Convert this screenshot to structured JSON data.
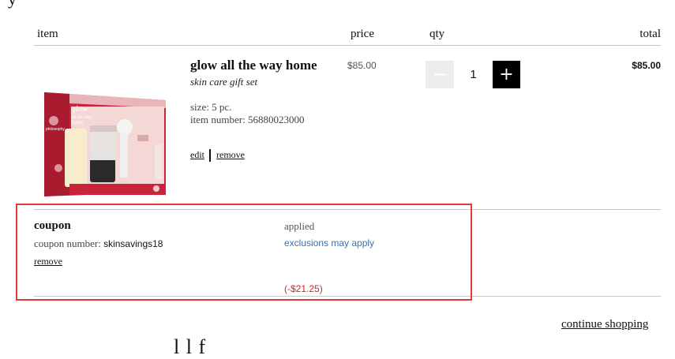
{
  "page": {
    "top_heading_fragment": "y",
    "bottom_heading_fragment": "l l f"
  },
  "table": {
    "headers": {
      "item": "item",
      "price": "price",
      "qty": "qty",
      "total": "total"
    }
  },
  "product": {
    "name": "glow all the way home",
    "subtitle": "skin care gift set",
    "size_label": "size:",
    "size_value": "5 pc.",
    "item_number_label": "item number:",
    "item_number_value": "56880023000",
    "edit_label": "edit",
    "remove_label": "remove",
    "price": "$85.00",
    "quantity": "1",
    "minus_symbol": "−",
    "plus_symbol": "+",
    "total": "$85.00",
    "image_icon": "gift-set-box-image",
    "image_text": {
      "brand": "philosophy",
      "line1": "glow",
      "line2": "all the way",
      "line3": "home"
    }
  },
  "coupon": {
    "title": "coupon",
    "number_label": "coupon number:",
    "number_value": "skinsavings18",
    "remove_label": "remove",
    "status": "applied",
    "exclusions_label": "exclusions may apply",
    "discount": "(-$21.25)"
  },
  "footer": {
    "continue_label": "continue shopping"
  },
  "colors": {
    "highlight_border": "#e23b3b",
    "discount_red": "#d12424",
    "link_blue": "#3d6fa4",
    "qty_plus_bg": "#000000",
    "qty_minus_bg": "#ececec"
  }
}
